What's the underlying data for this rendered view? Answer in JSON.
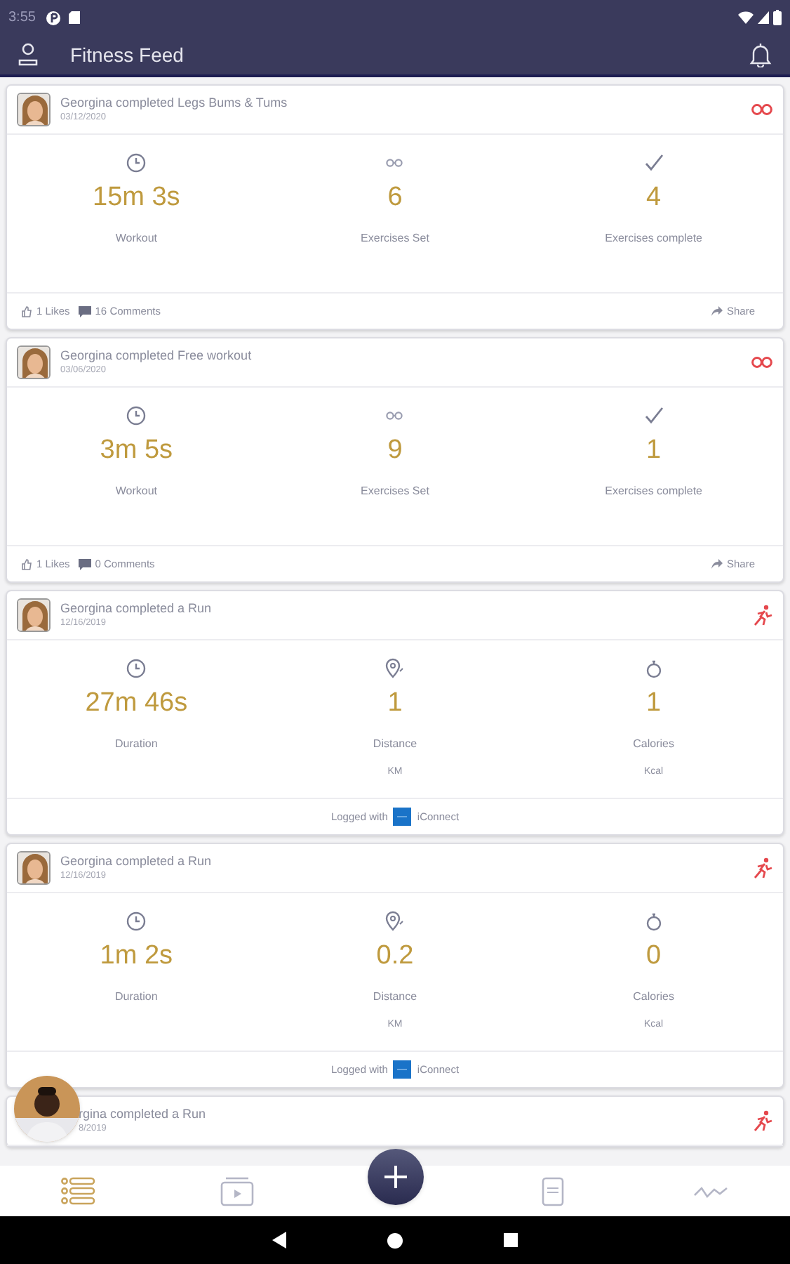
{
  "status_bar": {
    "time": "3:55"
  },
  "app_bar": {
    "title": "Fitness Feed"
  },
  "feed": [
    {
      "kind": "workout",
      "title": "Georgina completed Legs Bums & Tums",
      "date": "03/12/2020",
      "stats": [
        {
          "kind": "time",
          "value": "15m 3s",
          "label": "Workout"
        },
        {
          "kind": "sets",
          "value": "6",
          "label": "Exercises Set"
        },
        {
          "kind": "check",
          "value": "4",
          "label": "Exercises complete"
        }
      ],
      "likes": "1 Likes",
      "comments": "16 Comments",
      "share": "Share"
    },
    {
      "kind": "workout",
      "title": "Georgina completed Free workout",
      "date": "03/06/2020",
      "stats": [
        {
          "kind": "time",
          "value": "3m 5s",
          "label": "Workout"
        },
        {
          "kind": "sets",
          "value": "9",
          "label": "Exercises Set"
        },
        {
          "kind": "check",
          "value": "1",
          "label": "Exercises complete"
        }
      ],
      "likes": "1 Likes",
      "comments": "0 Comments",
      "share": "Share"
    },
    {
      "kind": "run",
      "title": "Georgina completed a Run",
      "date": "12/16/2019",
      "stats": [
        {
          "kind": "time",
          "value": "27m 46s",
          "label": "Duration"
        },
        {
          "kind": "distance",
          "value": "1",
          "label": "Distance",
          "unit": "KM"
        },
        {
          "kind": "calories",
          "value": "1",
          "label": "Calories",
          "unit": "Kcal"
        }
      ],
      "logged_with": "Logged with",
      "service": "iConnect"
    },
    {
      "kind": "run",
      "title": "Georgina completed a Run",
      "date": "12/16/2019",
      "stats": [
        {
          "kind": "time",
          "value": "1m 2s",
          "label": "Duration"
        },
        {
          "kind": "distance",
          "value": "0.2",
          "label": "Distance",
          "unit": "KM"
        },
        {
          "kind": "calories",
          "value": "0",
          "label": "Calories",
          "unit": "Kcal"
        }
      ],
      "logged_with": "Logged with",
      "service": "iConnect"
    },
    {
      "kind": "run",
      "title": "rgina completed a Run",
      "date": "8/2019",
      "partial": true
    }
  ],
  "bottom_nav": [
    {
      "selected": true
    },
    {
      "selected": false
    },
    {
      "selected": false
    },
    {
      "selected": false
    }
  ]
}
